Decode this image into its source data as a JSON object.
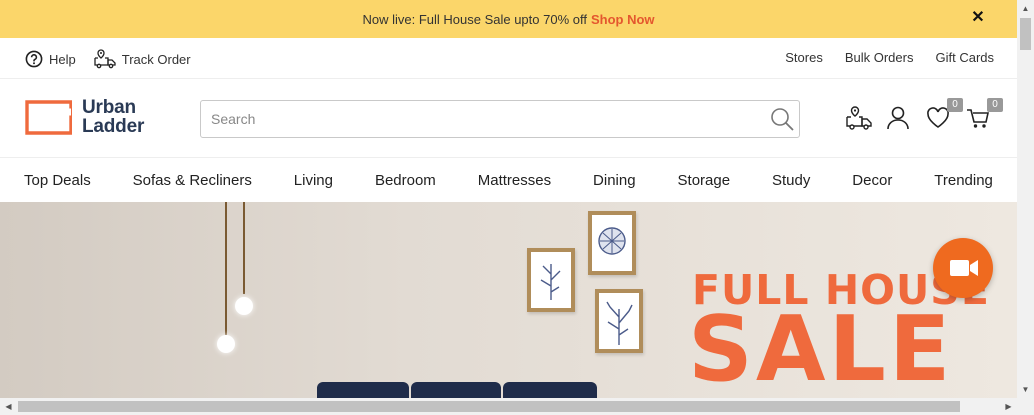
{
  "promo": {
    "text": "Now live: Full House Sale upto 70% off",
    "link": "Shop Now",
    "close": "✕"
  },
  "util": {
    "help": "Help",
    "track": "Track Order",
    "links": [
      "Stores",
      "Bulk Orders",
      "Gift Cards"
    ]
  },
  "logo": {
    "line1": "Urban",
    "line2": "Ladder"
  },
  "search": {
    "placeholder": "Search",
    "value": ""
  },
  "header_icons": {
    "wishlist_count": "0",
    "cart_count": "0"
  },
  "nav": [
    "Top Deals",
    "Sofas & Recliners",
    "Living",
    "Bedroom",
    "Mattresses",
    "Dining",
    "Storage",
    "Study",
    "Decor",
    "Trending"
  ],
  "hero": {
    "line1": "FULL HOUSE",
    "line2": "SALE"
  },
  "colors": {
    "promo_bg": "#fbd66a",
    "accent": "#ef6a3d",
    "brand_navy": "#2a3a55"
  }
}
